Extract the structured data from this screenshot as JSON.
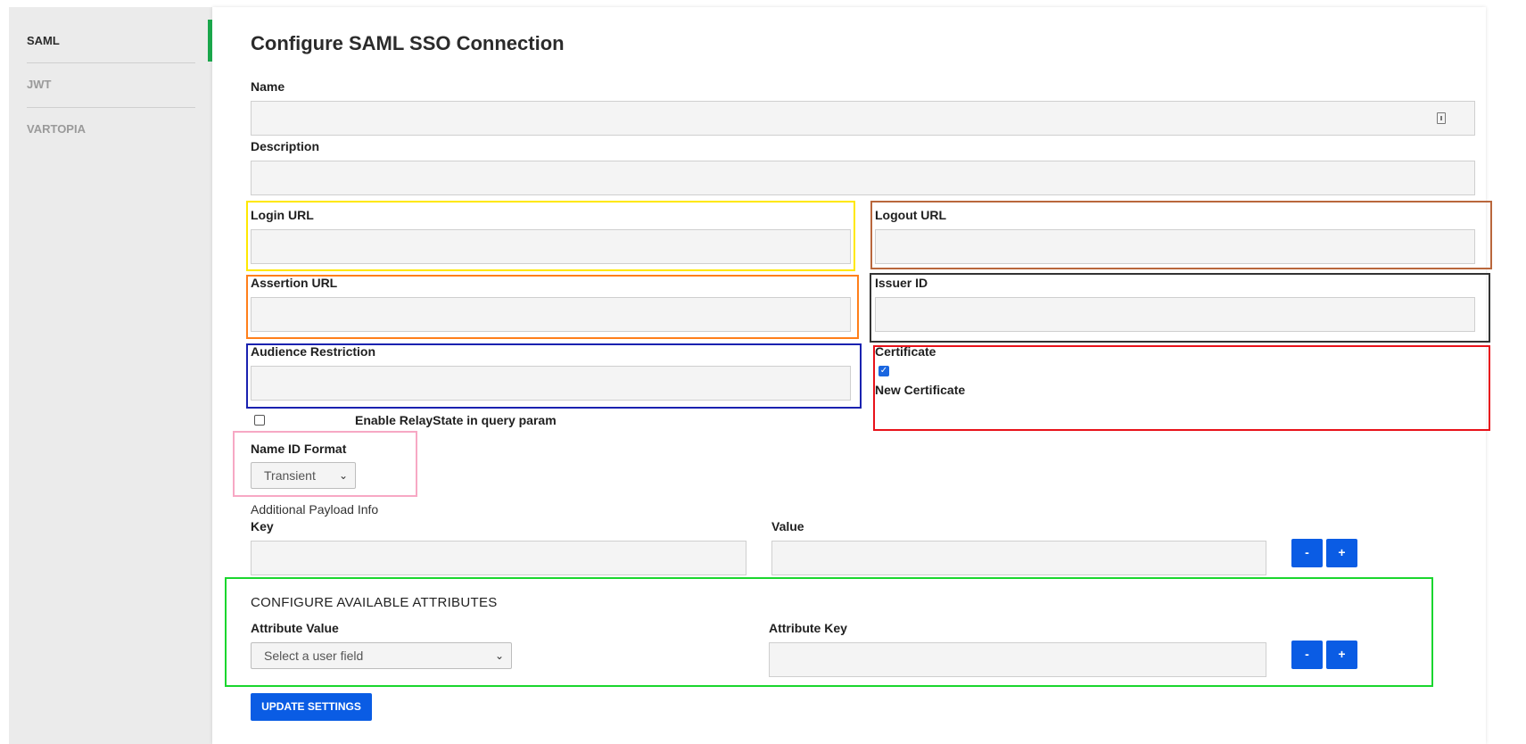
{
  "sidebar": {
    "items": [
      {
        "label": "SAML",
        "active": true
      },
      {
        "label": "JWT",
        "active": false
      },
      {
        "label": "VARTOPIA",
        "active": false
      }
    ]
  },
  "page": {
    "title": "Configure SAML SSO Connection"
  },
  "form": {
    "name_label": "Name",
    "name_value": "",
    "description_label": "Description",
    "description_value": "",
    "login_url_label": "Login URL",
    "logout_url_label": "Logout URL",
    "assertion_url_label": "Assertion URL",
    "issuer_id_label": "Issuer ID",
    "audience_restriction_label": "Audience Restriction",
    "certificate_label": "Certificate",
    "certificate_checked": true,
    "new_certificate_label": "New Certificate",
    "relaystate_label": "Enable RelayState in query param",
    "relaystate_checked": false,
    "name_id_format_label": "Name ID Format",
    "name_id_format_value": "Transient",
    "additional_payload_label": "Additional Payload Info",
    "key_label": "Key",
    "value_label": "Value",
    "minus_label": "-",
    "plus_label": "+"
  },
  "attributes": {
    "heading": "CONFIGURE AVAILABLE ATTRIBUTES",
    "attribute_value_label": "Attribute Value",
    "attribute_value_placeholder": "Select a user field",
    "attribute_key_label": "Attribute Key",
    "minus_label": "-",
    "plus_label": "+"
  },
  "actions": {
    "update_label": "UPDATE SETTINGS"
  },
  "colors": {
    "accent_green": "#1aa64b",
    "button_blue": "#0a5ce4",
    "highlight_yellow": "#ffe800",
    "highlight_brown": "#b9673c",
    "highlight_orange": "#ff7f1a",
    "highlight_dark": "#333333",
    "highlight_blue": "#1a22b0",
    "highlight_red": "#e8121a",
    "highlight_pink": "#f7a8c4",
    "highlight_green": "#1ad62e"
  },
  "icons": {
    "name_field_icon": "document-icon",
    "select_chevron": "chevron-down-icon",
    "checkbox_check": "checkmark-icon"
  }
}
